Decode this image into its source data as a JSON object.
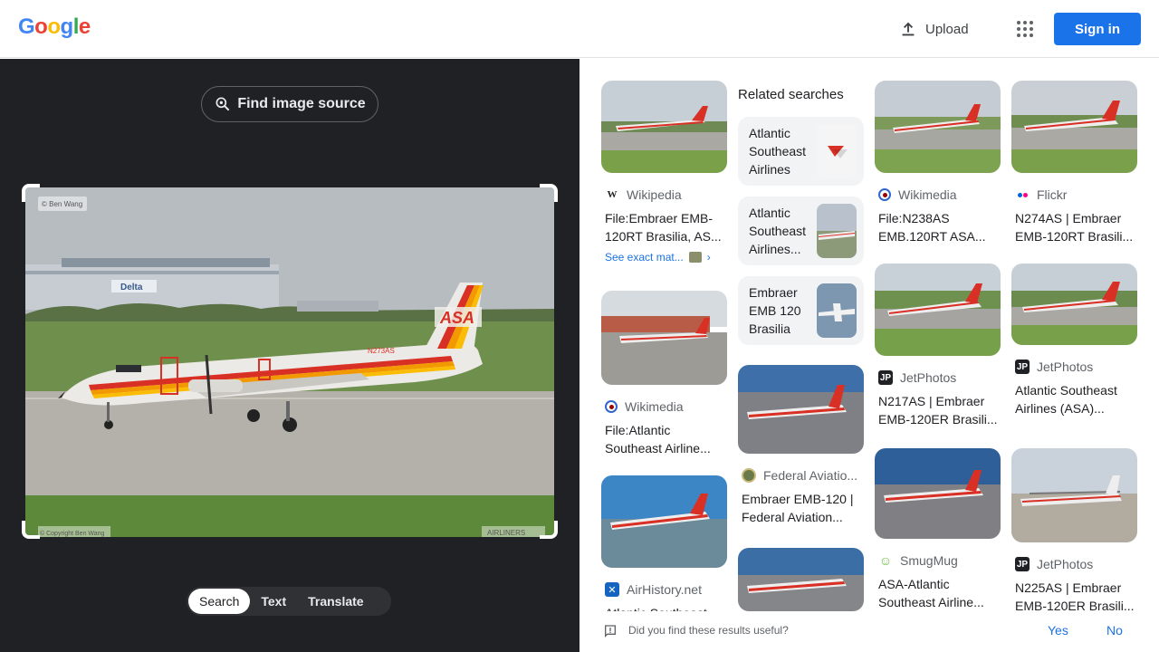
{
  "header": {
    "logo_letters": [
      "G",
      "o",
      "o",
      "g",
      "l",
      "e"
    ],
    "logo_colors": [
      "#4285f4",
      "#ea4335",
      "#fbbc05",
      "#4285f4",
      "#34a853",
      "#ea4335"
    ],
    "upload_label": "Upload",
    "apps_icon": "apps-grid-icon",
    "signin_label": "Sign in"
  },
  "left": {
    "find_source_label": "Find image source",
    "image_watermark_top": "© Ben Wang",
    "image_watermark_bottom_left": "© Copyright Ben Wang",
    "image_watermark_bottom_right": "AIRLINERS",
    "hangar_label": "Delta",
    "tail_label": "ASA",
    "reg_label": "N273AS",
    "modes": [
      "Search",
      "Text",
      "Translate"
    ],
    "active_mode": "Search"
  },
  "results": {
    "col1": [
      {
        "source": "Wikipedia",
        "icon": "wikipedia-icon",
        "title": "File:Embraer EMB-120RT Brasilia, AS...",
        "exact": "See exact mat..."
      },
      {
        "source": "Wikimedia",
        "icon": "wikimedia-icon",
        "title": "File:Atlantic Southeast Airline..."
      },
      {
        "source": "AirHistory.net",
        "icon": "airhistory-icon",
        "title": "Atlantic Southeast..."
      }
    ],
    "related_heading": "Related searches",
    "related": [
      {
        "label": "Atlantic Southeast Airlines"
      },
      {
        "label": "Atlantic Southeast Airlines..."
      },
      {
        "label": "Embraer EMB 120 Brasilia"
      }
    ],
    "col2": [
      {
        "source": "Federal Aviatio...",
        "icon": "faa-seal-icon",
        "title": "Embraer EMB-120 | Federal Aviation..."
      }
    ],
    "col3": [
      {
        "source": "Wikimedia",
        "icon": "wikimedia-icon",
        "title": "File:N238AS EMB.120RT ASA..."
      },
      {
        "source": "JetPhotos",
        "icon": "jetphotos-icon",
        "title": "N217AS | Embraer EMB-120ER Brasili..."
      },
      {
        "source": "SmugMug",
        "icon": "smugmug-icon",
        "title": "ASA-Atlantic Southeast Airline..."
      }
    ],
    "col4": [
      {
        "source": "Flickr",
        "icon": "flickr-icon",
        "title": "N274AS | Embraer EMB-120RT Brasili..."
      },
      {
        "source": "JetPhotos",
        "icon": "jetphotos-icon",
        "title": "Atlantic Southeast Airlines (ASA)..."
      },
      {
        "source": "JetPhotos",
        "icon": "jetphotos-icon",
        "title": "N225AS | Embraer EMB-120ER Brasili..."
      }
    ]
  },
  "feedback": {
    "question": "Did you find these results useful?",
    "yes": "Yes",
    "no": "No"
  },
  "colors": {
    "accent": "#1a73e8",
    "dark_bg": "#202124",
    "asa_red": "#d93025",
    "asa_orange": "#f29900"
  }
}
